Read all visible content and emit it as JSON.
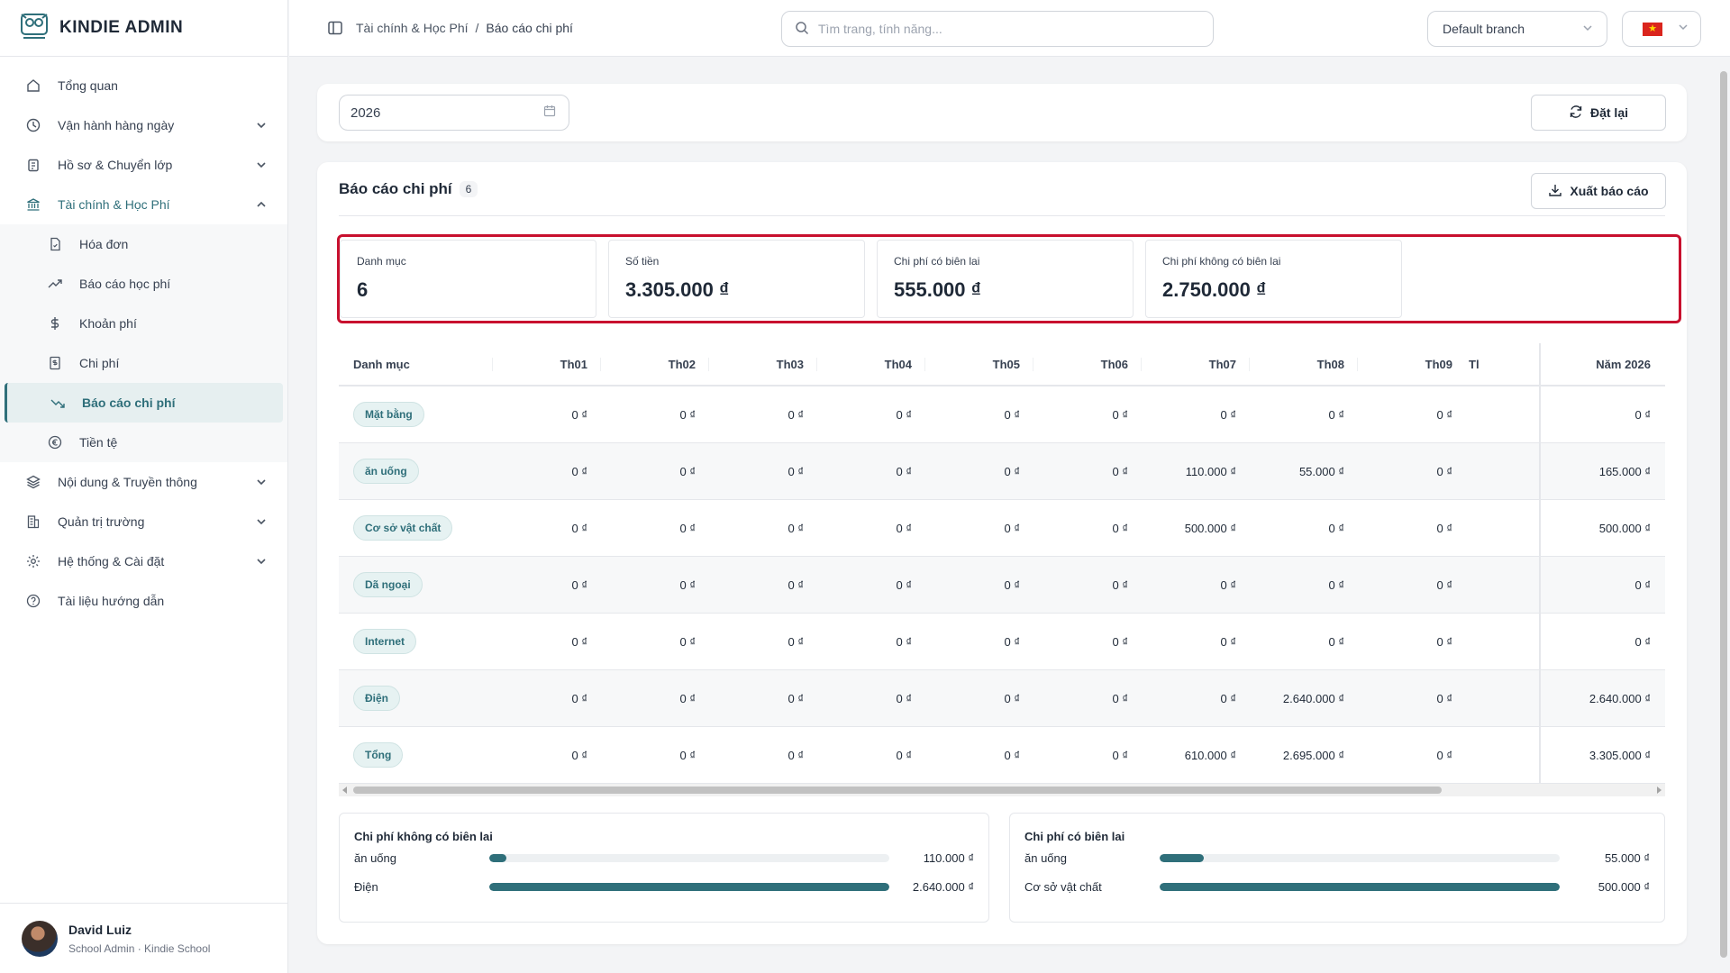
{
  "brand": {
    "name": "KINDIE ADMIN"
  },
  "sidebar": {
    "items": [
      {
        "label": "Tổng quan"
      },
      {
        "label": "Vận hành hàng ngày"
      },
      {
        "label": "Hồ sơ & Chuyển lớp"
      },
      {
        "label": "Tài chính & Học Phí"
      },
      {
        "label": "Nội dung & Truyền thông"
      },
      {
        "label": "Quản trị trường"
      },
      {
        "label": "Hệ thống & Cài đặt"
      },
      {
        "label": "Tài liệu hướng dẫn"
      }
    ],
    "subitems": [
      {
        "label": "Hóa đơn"
      },
      {
        "label": "Báo cáo học phí"
      },
      {
        "label": "Khoản phí"
      },
      {
        "label": "Chi phí"
      },
      {
        "label": "Báo cáo chi phí"
      },
      {
        "label": "Tiền tệ"
      }
    ]
  },
  "user": {
    "name": "David Luiz",
    "role": "School Admin · Kindie School"
  },
  "header": {
    "breadcrumb": [
      "Tài chính & Học Phí",
      "/",
      "Báo cáo chi phí"
    ],
    "search_placeholder": "Tìm trang, tính năng...",
    "branch": "Default branch"
  },
  "filter": {
    "year": "2026",
    "reset_label": "Đặt lại"
  },
  "report": {
    "title": "Báo cáo chi phí",
    "count": "6",
    "export_label": "Xuất báo cáo",
    "stats": [
      {
        "label": "Danh mục",
        "value": "6"
      },
      {
        "label": "Số tiền",
        "value": "3.305.000 ₫"
      },
      {
        "label": "Chi phí có biên lai",
        "value": "555.000 ₫"
      },
      {
        "label": "Chi phí không có biên lai",
        "value": "2.750.000 ₫"
      }
    ]
  },
  "table": {
    "headers": [
      "Danh mục",
      "Th01",
      "Th02",
      "Th03",
      "Th04",
      "Th05",
      "Th06",
      "Th07",
      "Th08",
      "Th09",
      "Tl",
      "Năm 2026"
    ],
    "rows": [
      {
        "name": "Mặt bằng",
        "months": [
          "0 ₫",
          "0 ₫",
          "0 ₫",
          "0 ₫",
          "0 ₫",
          "0 ₫",
          "0 ₫",
          "0 ₫",
          "0 ₫"
        ],
        "year": "0 ₫"
      },
      {
        "name": "ăn uống",
        "months": [
          "0 ₫",
          "0 ₫",
          "0 ₫",
          "0 ₫",
          "0 ₫",
          "0 ₫",
          "110.000 ₫",
          "55.000 ₫",
          "0 ₫"
        ],
        "year": "165.000 ₫"
      },
      {
        "name": "Cơ sở vật chất",
        "months": [
          "0 ₫",
          "0 ₫",
          "0 ₫",
          "0 ₫",
          "0 ₫",
          "0 ₫",
          "500.000 ₫",
          "0 ₫",
          "0 ₫"
        ],
        "year": "500.000 ₫"
      },
      {
        "name": "Dã ngoại",
        "months": [
          "0 ₫",
          "0 ₫",
          "0 ₫",
          "0 ₫",
          "0 ₫",
          "0 ₫",
          "0 ₫",
          "0 ₫",
          "0 ₫"
        ],
        "year": "0 ₫"
      },
      {
        "name": "Internet",
        "months": [
          "0 ₫",
          "0 ₫",
          "0 ₫",
          "0 ₫",
          "0 ₫",
          "0 ₫",
          "0 ₫",
          "0 ₫",
          "0 ₫"
        ],
        "year": "0 ₫"
      },
      {
        "name": "Điện",
        "months": [
          "0 ₫",
          "0 ₫",
          "0 ₫",
          "0 ₫",
          "0 ₫",
          "0 ₫",
          "0 ₫",
          "2.640.000 ₫",
          "0 ₫"
        ],
        "year": "2.640.000 ₫"
      },
      {
        "name": "Tổng",
        "months": [
          "0 ₫",
          "0 ₫",
          "0 ₫",
          "0 ₫",
          "0 ₫",
          "0 ₫",
          "610.000 ₫",
          "2.695.000 ₫",
          "0 ₫"
        ],
        "year": "3.305.000 ₫"
      }
    ]
  },
  "breakdown": [
    {
      "title": "Chi phí không có biên lai",
      "items": [
        {
          "label": "ăn uống",
          "value": "110.000 ₫",
          "fraction": 0.042
        },
        {
          "label": "Điện",
          "value": "2.640.000 ₫",
          "fraction": 1.0
        }
      ]
    },
    {
      "title": "Chi phí có biên lai",
      "items": [
        {
          "label": "ăn uống",
          "value": "55.000 ₫",
          "fraction": 0.11
        },
        {
          "label": "Cơ sở vật chất",
          "value": "500.000 ₫",
          "fraction": 1.0
        }
      ]
    }
  ],
  "colors": {
    "accent": "#2f6f7a",
    "highlight_border": "#c8102e"
  },
  "icons": [
    "owl-logo-icon",
    "home-icon",
    "clock-icon",
    "clipboard-icon",
    "bank-icon",
    "file-icon",
    "trend-up-icon",
    "dollar-icon",
    "receipt-icon",
    "trend-down-icon",
    "euro-icon",
    "layers-icon",
    "building-icon",
    "gear-icon",
    "help-icon",
    "sidebar-toggle-icon",
    "search-icon",
    "chevron-down-icon",
    "calendar-icon",
    "refresh-icon",
    "download-icon",
    "vietnam-flag-icon"
  ]
}
